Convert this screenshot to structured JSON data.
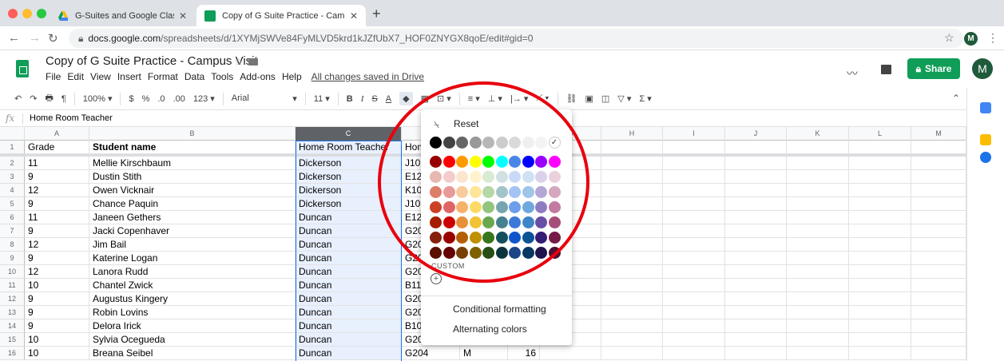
{
  "browser": {
    "tabs": [
      {
        "title": "G-Suites and Google Classroo",
        "active": false
      },
      {
        "title": "Copy of G Suite Practice - Cam",
        "active": true
      }
    ],
    "url_host": "docs.google.com",
    "url_path": "/spreadsheets/d/1XYMjSWVe84FyMLVD5krd1kJZfUbX7_HOF0ZNYGX8qoE/edit#gid=0",
    "profile_initial": "M"
  },
  "doc": {
    "title": "Copy of  G Suite Practice - Campus Visit",
    "menus": [
      "File",
      "Edit",
      "View",
      "Insert",
      "Format",
      "Data",
      "Tools",
      "Add-ons",
      "Help"
    ],
    "saved_status": "All changes saved in Drive",
    "share_label": "Share",
    "avatar_initial": "M"
  },
  "toolbar": {
    "zoom": "100%",
    "currency": "$",
    "percent": "%",
    "dec_less": ".0",
    "dec_more": ".00",
    "more_formats": "123",
    "font": "Arial",
    "font_size": "11",
    "bold": "B",
    "italic": "I",
    "strike": "S",
    "text_color": "A"
  },
  "formula": {
    "fx": "fx",
    "value": "Home Room Teacher"
  },
  "columns": [
    "A",
    "B",
    "C",
    "D",
    "E",
    "F",
    "G",
    "H",
    "I",
    "J",
    "K",
    "L",
    "M"
  ],
  "selected_column": "C",
  "rows": [
    {
      "n": "1",
      "a": "Grade",
      "b": "Student name",
      "c": "Home Room Teacher",
      "d": "Home"
    },
    {
      "n": "2",
      "a": "11",
      "b": "Mellie Kirschbaum",
      "c": "Dickerson",
      "d": "J102"
    },
    {
      "n": "3",
      "a": "9",
      "b": "Dustin Stith",
      "c": "Dickerson",
      "d": "E121"
    },
    {
      "n": "4",
      "a": "12",
      "b": "Owen Vicknair",
      "c": "Dickerson",
      "d": "K102"
    },
    {
      "n": "5",
      "a": "9",
      "b": "Chance Paquin",
      "c": "Dickerson",
      "d": "J102"
    },
    {
      "n": "6",
      "a": "11",
      "b": "Janeen Gethers",
      "c": "Duncan",
      "d": "E124"
    },
    {
      "n": "7",
      "a": "9",
      "b": "Jacki Copenhaver",
      "c": "Duncan",
      "d": "G204"
    },
    {
      "n": "8",
      "a": "12",
      "b": "Jim Bail",
      "c": "Duncan",
      "d": "G203"
    },
    {
      "n": "9",
      "a": "9",
      "b": "Katerine Logan",
      "c": "Duncan",
      "d": "G201"
    },
    {
      "n": "10",
      "a": "12",
      "b": "Lanora Rudd",
      "c": "Duncan",
      "d": "G204"
    },
    {
      "n": "11",
      "a": "10",
      "b": "Chantel Zwick",
      "c": "Duncan",
      "d": "B110"
    },
    {
      "n": "12",
      "a": "9",
      "b": "Augustus Kingery",
      "c": "Duncan",
      "d": "G203"
    },
    {
      "n": "13",
      "a": "9",
      "b": "Robin Lovins",
      "c": "Duncan",
      "d": "G203"
    },
    {
      "n": "14",
      "a": "9",
      "b": "Delora Irick",
      "c": "Duncan",
      "d": "B106"
    },
    {
      "n": "15",
      "a": "10",
      "b": "Sylvia Ocegueda",
      "c": "Duncan",
      "d": "G201"
    },
    {
      "n": "16",
      "a": "10",
      "b": "Breana Seibel",
      "c": "Duncan",
      "d": "G204",
      "e": "M",
      "f": "16"
    }
  ],
  "palette": {
    "reset_label": "Reset",
    "custom_label": "CUSTOM",
    "conditional_label": "Conditional formatting",
    "alternating_label": "Alternating colors",
    "colors": [
      [
        "#000000",
        "#434343",
        "#666666",
        "#999999",
        "#b7b7b7",
        "#cccccc",
        "#d9d9d9",
        "#efefef",
        "#f3f3f3",
        "#ffffff"
      ],
      [
        "#980000",
        "#ff0000",
        "#ff9900",
        "#ffff00",
        "#00ff00",
        "#00ffff",
        "#4a86e8",
        "#0000ff",
        "#9900ff",
        "#ff00ff"
      ],
      [
        "#e6b8af",
        "#f4cccc",
        "#fce5cd",
        "#fff2cc",
        "#d9ead3",
        "#d0e0e3",
        "#c9daf8",
        "#cfe2f3",
        "#d9d2e9",
        "#ead1dc"
      ],
      [
        "#dd7e6b",
        "#ea9999",
        "#f9cb9c",
        "#ffe599",
        "#b6d7a8",
        "#a2c4c9",
        "#a4c2f4",
        "#9fc5e8",
        "#b4a7d6",
        "#d5a6bd"
      ],
      [
        "#cc4125",
        "#e06666",
        "#f6b26b",
        "#ffd966",
        "#93c47d",
        "#76a5af",
        "#6d9eeb",
        "#6fa8dc",
        "#8e7cc3",
        "#c27ba0"
      ],
      [
        "#a61c00",
        "#cc0000",
        "#e69138",
        "#f1c232",
        "#6aa84f",
        "#45818e",
        "#3c78d8",
        "#3d85c6",
        "#674ea7",
        "#a64d79"
      ],
      [
        "#85200c",
        "#990000",
        "#b45f06",
        "#bf9000",
        "#38761d",
        "#134f5c",
        "#1155cc",
        "#0b5394",
        "#351c75",
        "#741b47"
      ],
      [
        "#5b0f00",
        "#660000",
        "#783f04",
        "#7f6000",
        "#274e13",
        "#0c343d",
        "#1c4587",
        "#073763",
        "#20124d",
        "#4c1130"
      ]
    ],
    "accent_circle": "#e8000d",
    "brand_green": "#0f9d58"
  }
}
